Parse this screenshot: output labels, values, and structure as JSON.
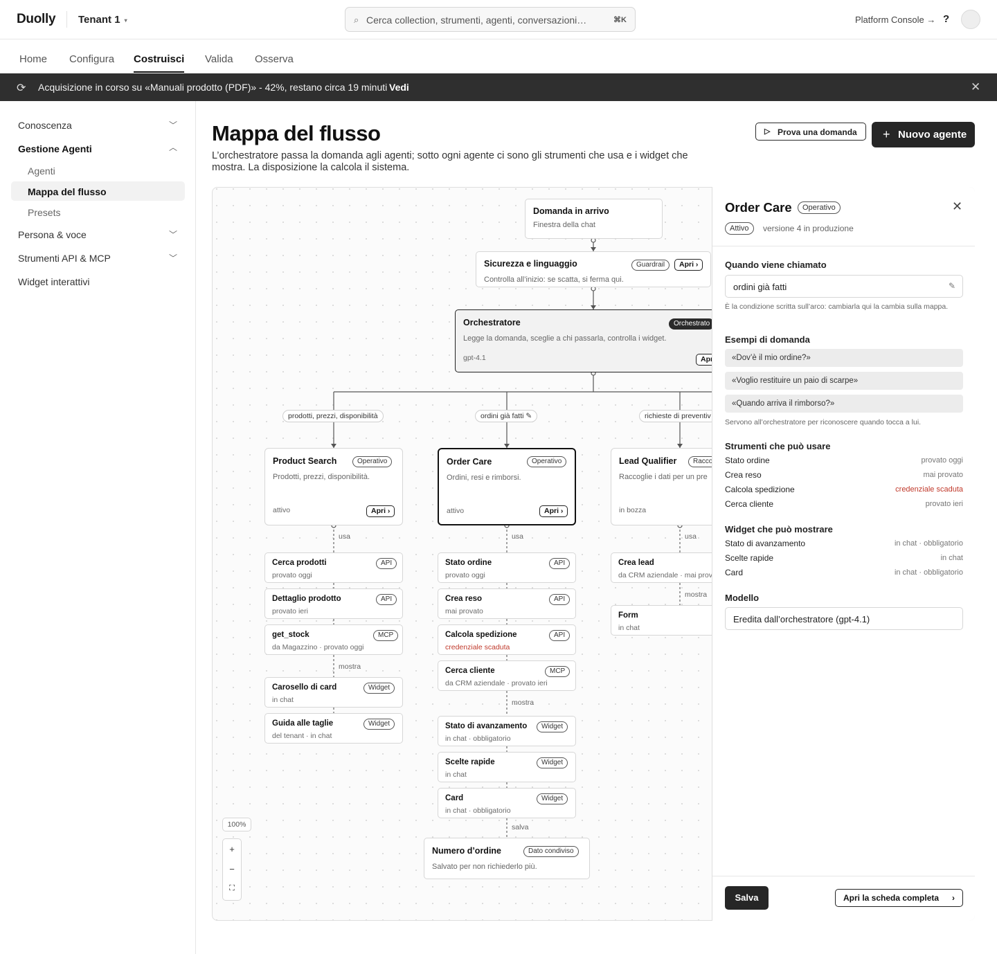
{
  "topbar": {
    "brand": "Duolly",
    "tenant": "Tenant 1",
    "tenant_caret": "▾",
    "search_placeholder": "Cerca collection, strumenti, agenti, conversazioni…",
    "search_shortcut": "⌘K",
    "platform_console": "Platform Console →",
    "help": "?"
  },
  "nav_tabs": [
    {
      "label": "Home"
    },
    {
      "label": "Configura"
    },
    {
      "label": "Costruisci",
      "active": true
    },
    {
      "label": "Valida"
    },
    {
      "label": "Osserva"
    }
  ],
  "banner": {
    "text": "Acquisizione in corso su «Manuali prodotto (PDF)» - 42%, restano circa 19 minuti",
    "link": "Vedi",
    "progress_percent": 42
  },
  "sidebar": {
    "sections": [
      {
        "label": "Conoscenza"
      },
      {
        "label": "Gestione Agenti",
        "expanded": true
      },
      {
        "label": "Persona & voce"
      },
      {
        "label": "Strumenti API & MCP"
      },
      {
        "label": "Widget interattivi"
      }
    ],
    "sub_items": [
      {
        "label": "Agenti"
      },
      {
        "label": "Mappa del flusso",
        "active": true
      },
      {
        "label": "Presets"
      }
    ]
  },
  "page": {
    "title": "Mappa del flusso",
    "description": "L’orchestratore passa la domanda agli agenti; sotto ogni agente ci sono gli strumenti che usa e i widget che mostra. La disposizione la calcola il sistema.",
    "try_button": "Prova una domanda",
    "new_agent_button": "Nuovo agente"
  },
  "flow": {
    "incoming": {
      "title": "Domanda in arrivo",
      "subtitle": "Finestra della chat"
    },
    "guardrail": {
      "title": "Sicurezza e linguaggio",
      "badge": "Guardrail",
      "open": "Apri ›",
      "subtitle": "Controlla all’inizio: se scatta, si ferma qui."
    },
    "orchestrator": {
      "title": "Orchestratore",
      "badge": "Orchestrato",
      "subtitle": "Legge la domanda, sceglie a chi passarla, controlla i widget.",
      "model": "gpt-4.1",
      "open": "Apr"
    },
    "edges": [
      "prodotti, prezzi, disponibilità",
      "ordini già fatti",
      "richieste di preventiv"
    ],
    "agents": [
      {
        "name": "Product Search",
        "badge": "Operativo",
        "desc": "Prodotti, prezzi, disponibilità.",
        "status": "attivo",
        "open": "Apri ›",
        "uses_label": "usa",
        "tools": [
          {
            "name": "Cerca prodotti",
            "kind": "API",
            "sub": "provato oggi"
          },
          {
            "name": "Dettaglio prodotto",
            "kind": "API",
            "sub": "provato ieri"
          },
          {
            "name": "get_stock",
            "kind": "MCP",
            "sub": "da Magazzino · provato oggi"
          }
        ],
        "shows_label": "mostra",
        "widgets": [
          {
            "name": "Carosello di card",
            "kind": "Widget",
            "sub": "in chat"
          },
          {
            "name": "Guida alle taglie",
            "kind": "Widget",
            "sub": "del tenant · in chat"
          }
        ]
      },
      {
        "name": "Order Care",
        "badge": "Operativo",
        "desc": "Ordini, resi e rimborsi.",
        "status": "attivo",
        "open": "Apri ›",
        "uses_label": "usa",
        "tools": [
          {
            "name": "Stato ordine",
            "kind": "API",
            "sub": "provato oggi"
          },
          {
            "name": "Crea reso",
            "kind": "API",
            "sub": "mai provato"
          },
          {
            "name": "Calcola spedizione",
            "kind": "API",
            "sub": "credenziale scaduta",
            "error": true
          },
          {
            "name": "Cerca cliente",
            "kind": "MCP",
            "sub": "da CRM aziendale · provato ieri"
          }
        ],
        "shows_label": "mostra",
        "widgets": [
          {
            "name": "Stato di avanzamento",
            "kind": "Widget",
            "sub": "in chat · obbligatorio"
          },
          {
            "name": "Scelte rapide",
            "kind": "Widget",
            "sub": "in chat"
          },
          {
            "name": "Card",
            "kind": "Widget",
            "sub": "in chat · obbligatorio"
          }
        ],
        "saves_label": "salva"
      },
      {
        "name": "Lead Qualifier",
        "badge": "Racco",
        "desc": "Raccoglie i dati per un pre",
        "status": "in bozza",
        "uses_label": "usa",
        "tools": [
          {
            "name": "Crea lead",
            "kind": "",
            "sub": "da CRM aziendale · mai prova"
          }
        ],
        "shows_label": "mostra",
        "widgets": [
          {
            "name": "Form",
            "kind": "",
            "sub": "in chat"
          }
        ]
      }
    ],
    "shared": {
      "title": "Numero d’ordine",
      "badge": "Dato condiviso",
      "subtitle": "Salvato per non richiederlo più."
    },
    "zoom": "100%",
    "zoom_in": "+",
    "zoom_out": "−",
    "fit": "⛶"
  },
  "panel": {
    "title": "Order Care",
    "status_badge": "Operativo",
    "active_badge": "Attivo",
    "version": "versione 4 in produzione",
    "trigger_label": "Quando viene chiamato",
    "trigger_value": "ordini già fatti",
    "trigger_note": "È la condizione scritta sull’arco: cambiarla qui la cambia sulla mappa.",
    "examples_label": "Esempi di domanda",
    "examples": [
      "«Dov’è il mio ordine?»",
      "«Voglio restituire un paio di scarpe»",
      "«Quando arriva il rimborso?»"
    ],
    "examples_note": "Servono all’orchestratore per riconoscere quando tocca a lui.",
    "tools_label": "Strumenti che può usare",
    "tools": [
      {
        "name": "Stato ordine",
        "status": "provato oggi"
      },
      {
        "name": "Crea reso",
        "status": "mai provato"
      },
      {
        "name": "Calcola spedizione",
        "status": "credenziale scaduta",
        "error": true
      },
      {
        "name": "Cerca cliente",
        "status": "provato ieri"
      }
    ],
    "widgets_label": "Widget che può mostrare",
    "widgets": [
      {
        "name": "Stato di avanzamento",
        "status": "in chat · obbligatorio"
      },
      {
        "name": "Scelte rapide",
        "status": "in chat"
      },
      {
        "name": "Card",
        "status": "in chat · obbligatorio"
      }
    ],
    "model_label": "Modello",
    "model_value": "Eredita dall’orchestratore (gpt-4.1)",
    "save": "Salva",
    "open_full": "Apri la scheda completa"
  },
  "colors": {
    "accent_dark": "#262626",
    "error": "#c0392b",
    "banner_bg": "#2f2f2f"
  }
}
